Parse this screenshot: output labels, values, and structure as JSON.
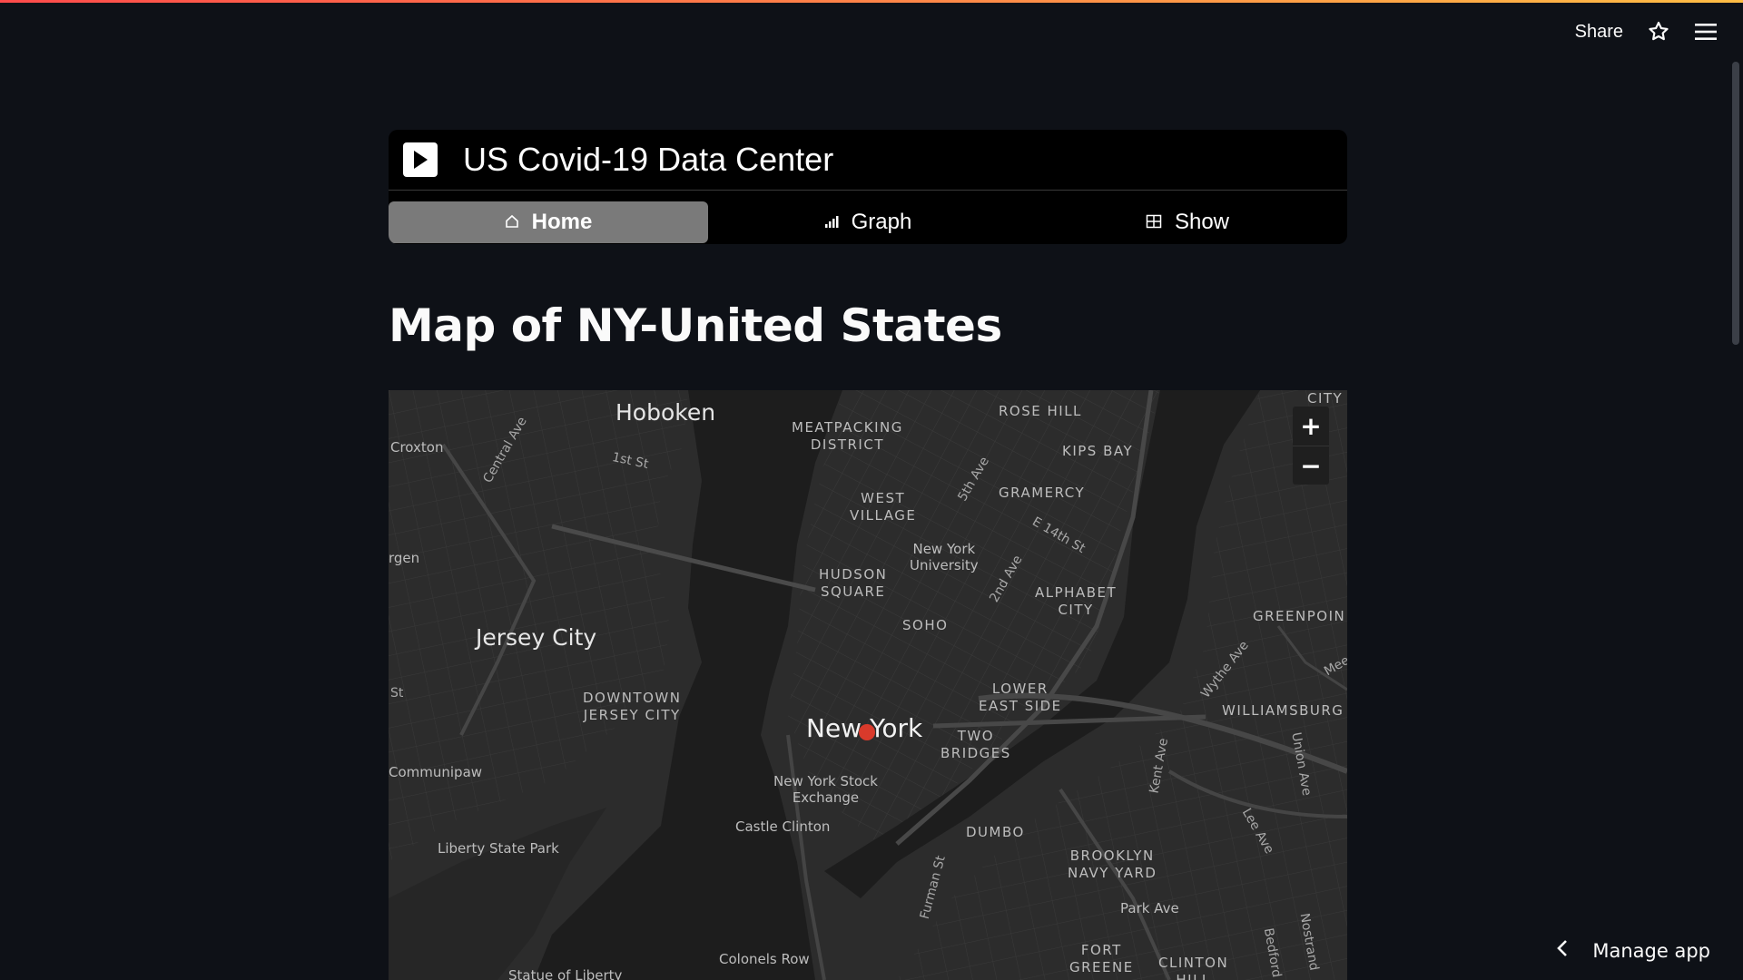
{
  "header": {
    "share_label": "Share",
    "star_icon": "star-icon",
    "menu_icon": "hamburger-menu-icon"
  },
  "nav_menu": {
    "title": "US Covid-19 Data Center",
    "logo_icon": "play-icon",
    "tabs": [
      {
        "label": "Home",
        "icon": "house-icon",
        "active": true
      },
      {
        "label": "Graph",
        "icon": "bar-chart-icon",
        "active": false
      },
      {
        "label": "Show",
        "icon": "table-icon",
        "active": false
      }
    ]
  },
  "main": {
    "title": "Map of NY-United States"
  },
  "map": {
    "zoom_in": "+",
    "zoom_out": "−",
    "marker_color": "#d93a2b",
    "labels": {
      "hoboken": "Hoboken",
      "croxton": "Croxton",
      "central_ave": "Central Ave",
      "first_st": "1st St",
      "meatpacking": "MEATPACKING\nDISTRICT",
      "rose_hill": "ROSE HILL",
      "kips_bay": "KIPS BAY",
      "city": "CITY",
      "fifth_ave": "5th Ave",
      "gramercy": "GRAMERCY",
      "west_village": "WEST\nVILLAGE",
      "e14th": "E 14th St",
      "nyu": "New York\nUniversity",
      "bergen": "rgen",
      "hudson_square": "HUDSON\nSQUARE",
      "second_ave": "2nd Ave",
      "alphabet_city": "ALPHABET\nCITY",
      "soho": "SOHO",
      "greenpoint": "GREENPOIN",
      "jersey_city": "Jersey City",
      "wythe_ave": "Wythe Ave",
      "mee": "Mee",
      "st": "St",
      "downtown_jc": "DOWNTOWN\nJERSEY CITY",
      "lower_east_side": "LOWER\nEAST SIDE",
      "williamsburg": "WILLIAMSBURG",
      "new_york": "New York",
      "two_bridges": "TWO\nBRIDGES",
      "kent_ave": "Kent Ave",
      "union_ave": "Union Ave",
      "communipaw": "Communipaw",
      "nyse": "New York Stock\nExchange",
      "castle_clinton": "Castle Clinton",
      "dumbo": "DUMBO",
      "lee_ave": "Lee Ave",
      "liberty_state_park": "Liberty State Park",
      "brooklyn_navy_yard": "BROOKLYN\nNAVY YARD",
      "furman_st": "Furman St",
      "park_ave": "Park Ave",
      "nostrand": "Nostrand",
      "bedford": "Bedford",
      "fort_greene": "FORT\nGREENE",
      "clinton_hill": "CLINTON\nHILL",
      "colonels_row": "Colonels Row",
      "statue_of_liberty": "Statue of Liberty"
    }
  },
  "footer": {
    "manage_app_label": "Manage app",
    "chevron_icon": "chevron-left-icon"
  }
}
